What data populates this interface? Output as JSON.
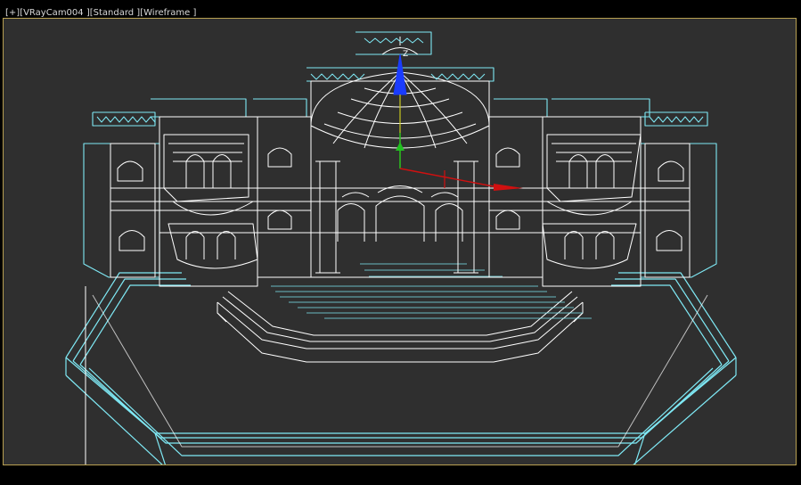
{
  "viewport": {
    "labels": {
      "plus": "[+]",
      "camera": "[VRayCam004 ]",
      "shading": "[Standard ]",
      "mode": "[Wireframe ]"
    },
    "colors": {
      "background": "#2f2f2f",
      "active_border": "#b8a052",
      "wire_selected": "#7fe9f5",
      "wire_default": "#ffffff",
      "gizmo_z": "#1a3cff",
      "gizmo_x": "#d01010",
      "gizmo_y": "#20c020"
    },
    "gizmo_label": "Z"
  }
}
